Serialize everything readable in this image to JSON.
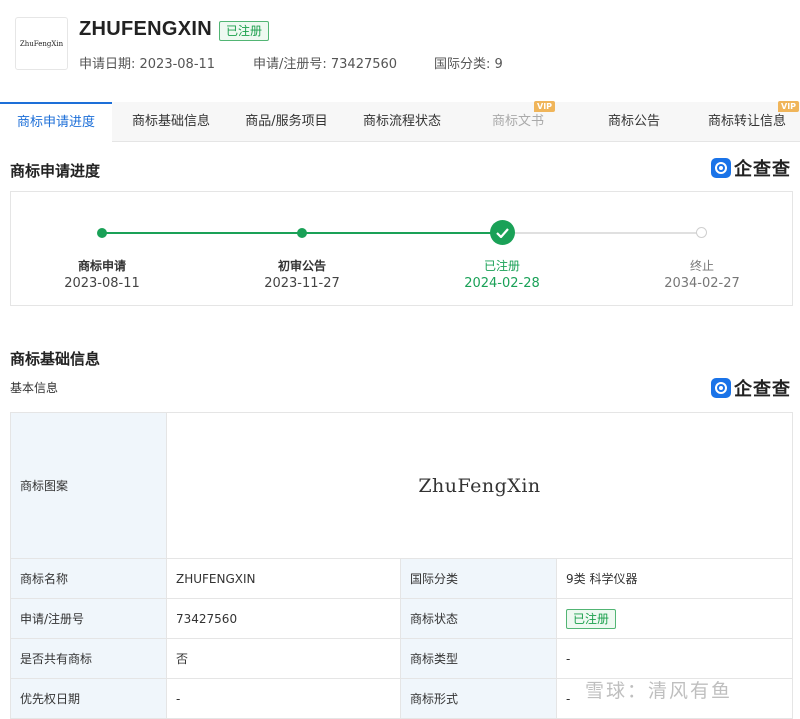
{
  "header": {
    "logo_text": "ZhuFengXin",
    "brand_name": "ZHUFENGXIN",
    "status_badge": "已注册",
    "apply_date": "申请日期: 2023-08-11",
    "reg_no": "申请/注册号: 73427560",
    "intl_class": "国际分类: 9"
  },
  "tabs": [
    {
      "label": "商标申请进度"
    },
    {
      "label": "商标基础信息"
    },
    {
      "label": "商品/服务项目"
    },
    {
      "label": "商标流程状态"
    },
    {
      "label": "商标文书",
      "vip": "VIP"
    },
    {
      "label": "商标公告"
    },
    {
      "label": "商标转让信息",
      "vip": "VIP"
    }
  ],
  "progress": {
    "title": "商标申请进度",
    "brand": "企查查",
    "steps": [
      {
        "name": "商标申请",
        "date": "2023-08-11"
      },
      {
        "name": "初审公告",
        "date": "2023-11-27"
      },
      {
        "name": "已注册",
        "date": "2024-02-28"
      },
      {
        "name": "终止",
        "date": "2034-02-27"
      }
    ]
  },
  "basic": {
    "title": "商标基础信息",
    "subtitle": "基本信息",
    "brand": "企查查",
    "image_label": "商标图案",
    "image_text": "ZhuFengXin",
    "rows": [
      {
        "l1": "商标名称",
        "v1": "ZHUFENGXIN",
        "l2": "国际分类",
        "v2": "9类 科学仪器"
      },
      {
        "l1": "申请/注册号",
        "v1": "73427560",
        "l2": "商标状态",
        "v2": "已注册"
      },
      {
        "l1": "是否共有商标",
        "v1": "否",
        "l2": "商标类型",
        "v2": "-"
      },
      {
        "l1": "优先权日期",
        "v1": "-",
        "l2": "商标形式",
        "v2": "-"
      }
    ]
  },
  "watermark": "雪球：清风有鱼",
  "colors": {
    "accent": "#1d6fd8",
    "green": "#1aa157",
    "label_bg": "#f0f6fb"
  }
}
